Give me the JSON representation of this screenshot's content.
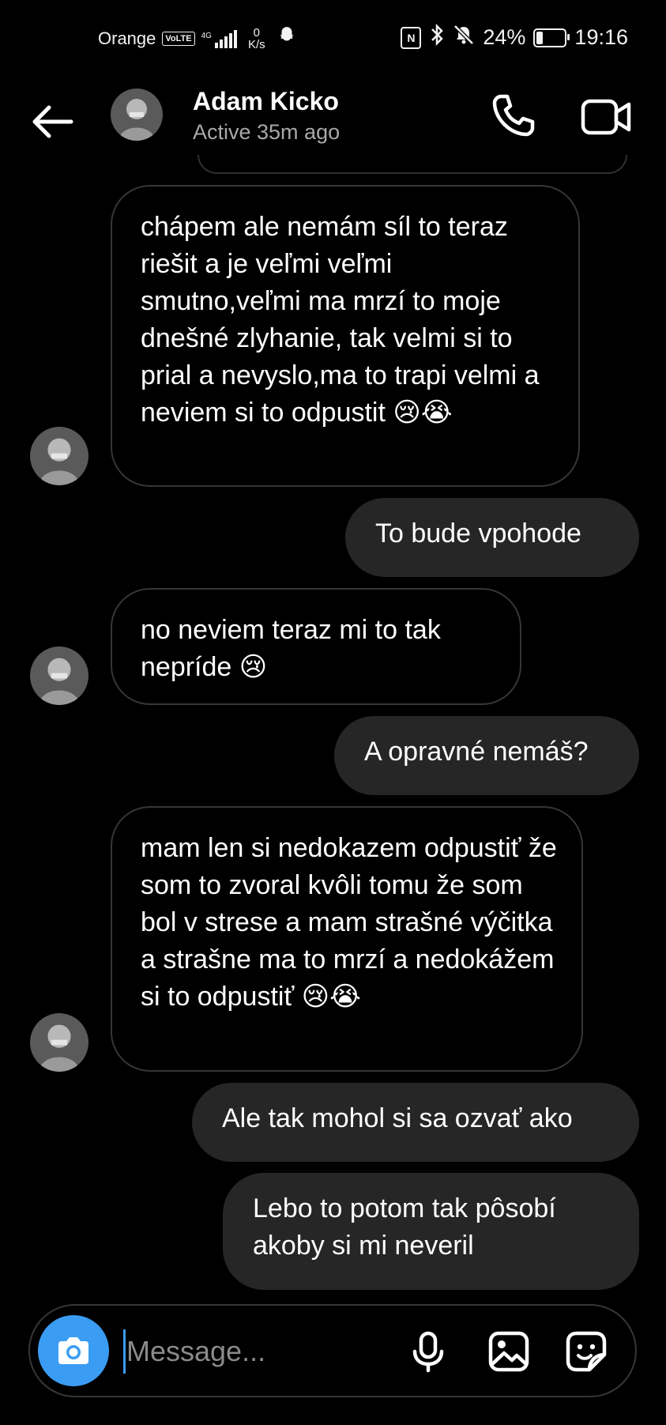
{
  "status_bar": {
    "carrier": "Orange",
    "volte": "VoLTE",
    "network": "4G",
    "speed_value": "0",
    "speed_unit": "K/s",
    "battery_percent": "24%",
    "battery_level": 0.24,
    "time": "19:16"
  },
  "header": {
    "contact_name": "Adam Kicko",
    "contact_status": "Active 35m ago",
    "icons": [
      "back-arrow-icon",
      "phone-icon",
      "video-camera-icon"
    ]
  },
  "messages": [
    {
      "from": "contact",
      "text": "chápem ale nemám síl to teraz riešit a je veľmi veľmi smutno,veľmi ma mrzí to moje dnešné zlyhanie, tak velmi si to prial a nevyslo,ma to trapi velmi a neviem si to odpustit",
      "emoji": "😢😭"
    },
    {
      "from": "me",
      "text": "To bude vpohode"
    },
    {
      "from": "contact",
      "text": "no neviem teraz mi to tak nepríde",
      "emoji": "😢"
    },
    {
      "from": "me",
      "text": "A opravné nemáš?"
    },
    {
      "from": "contact",
      "text": "mam len si nedokazem odpustiť že som to zvoral kvôli tomu že som bol v strese a mam strašné výčitka a strašne ma to mrzí a nedokážem si to odpustiť",
      "emoji": "😢😭"
    },
    {
      "from": "me",
      "text": "Ale tak mohol si sa ozvať ako"
    },
    {
      "from": "me",
      "text": "Lebo to potom tak pôsobí akoby si mi neveril"
    }
  ],
  "composer": {
    "placeholder": "Message...",
    "icons": [
      "camera-icon",
      "microphone-icon",
      "gallery-icon",
      "sticker-icon"
    ]
  },
  "colors": {
    "background": "#000000",
    "outgoing_bubble": "#262626",
    "incoming_border": "#363636",
    "accent": "#3b9cf4",
    "secondary_text": "#a8a8a8"
  }
}
